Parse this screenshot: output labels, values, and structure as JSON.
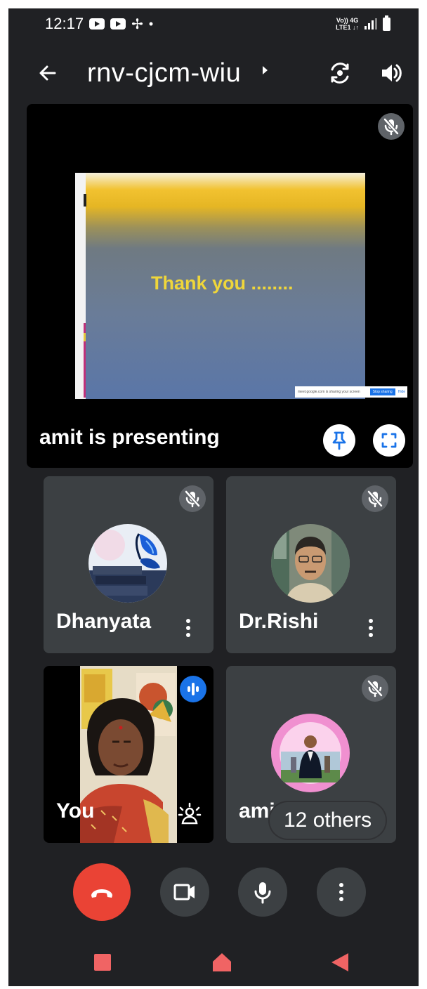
{
  "status_bar": {
    "time": "12:17",
    "network_line1": "Vo)) 4G",
    "network_line2": "LTE1 ↓↑"
  },
  "header": {
    "meeting_code": "rnv-cjcm-wiu"
  },
  "presentation": {
    "slide_text": "Thank you ........",
    "share_banner_text": "meet.google.com is sharing your screen",
    "share_stop_label": "Stop sharing",
    "share_hide_label": "Hide",
    "presenting_label": "amit is presenting"
  },
  "participants": {
    "p1_name": "Dhanyata",
    "p2_name": "Dr.Rishi",
    "self_name": "You",
    "p4_name": "amit",
    "others_label": "12 others"
  },
  "colors": {
    "background": "#202124",
    "tile": "#3c4043",
    "end_call": "#ea4335",
    "speaking": "#1a73e8",
    "slide_text": "#efd63a"
  },
  "icons": [
    "back-arrow-icon",
    "chevron-right-icon",
    "camera-flip-icon",
    "speaker-icon",
    "mic-off-icon",
    "pin-icon",
    "fullscreen-icon",
    "more-vert-icon",
    "audio-level-icon",
    "visual-effects-icon",
    "end-call-icon",
    "camera-icon",
    "mic-icon",
    "overview-icon",
    "home-icon",
    "back-icon"
  ]
}
